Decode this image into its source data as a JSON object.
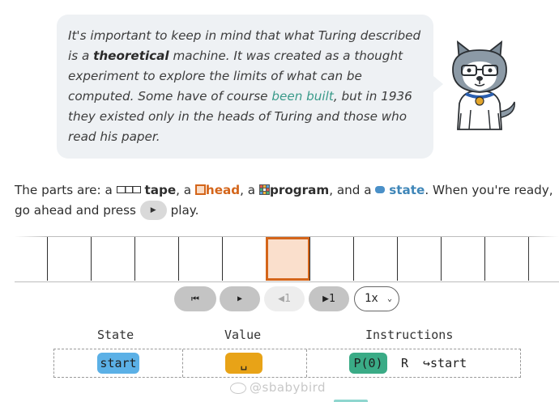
{
  "bubble": {
    "p1": "It's important to keep in mind that what Turing described is a ",
    "bold": "theoretical",
    "p2": " machine. It was created as a thought experiment to explore the limits of what can be computed. Some have of course ",
    "link": "been built",
    "p3": ", but in 1936 they existed only in the heads of Turing and those who read his paper."
  },
  "mascot": {
    "icon": "husky-mascot-icon"
  },
  "parts": {
    "intro": "The parts are: a ",
    "tape": "tape",
    "sep1": ", a ",
    "head": "head",
    "sep2": ", a ",
    "program": "program",
    "sep3": ", and a ",
    "state": "state",
    "outro": ". When you're ready, go ahead and press ",
    "end": " play.",
    "colors": {
      "head": "#d4651a",
      "state": "#3f86b8",
      "state_icon": "#4a90c8"
    }
  },
  "tape": {
    "cell_count": 12,
    "head_index": 5
  },
  "controls": {
    "rewind": "⏮",
    "play": "▶",
    "step_back_label": "◀1",
    "step_forward_label": "▶1",
    "speed_value": "1x",
    "speed_chevron": "⌄"
  },
  "table": {
    "headers": {
      "state": "State",
      "value": "Value",
      "instructions": "Instructions"
    },
    "row": {
      "state": "start",
      "value": "␣",
      "instr_print": "P(0)",
      "instr_move": "R",
      "instr_next": "↪start"
    },
    "colors": {
      "state": "#5bb0e6",
      "value": "#e8a317",
      "print": "#3aab86"
    }
  },
  "watermark": "@sbabybird"
}
